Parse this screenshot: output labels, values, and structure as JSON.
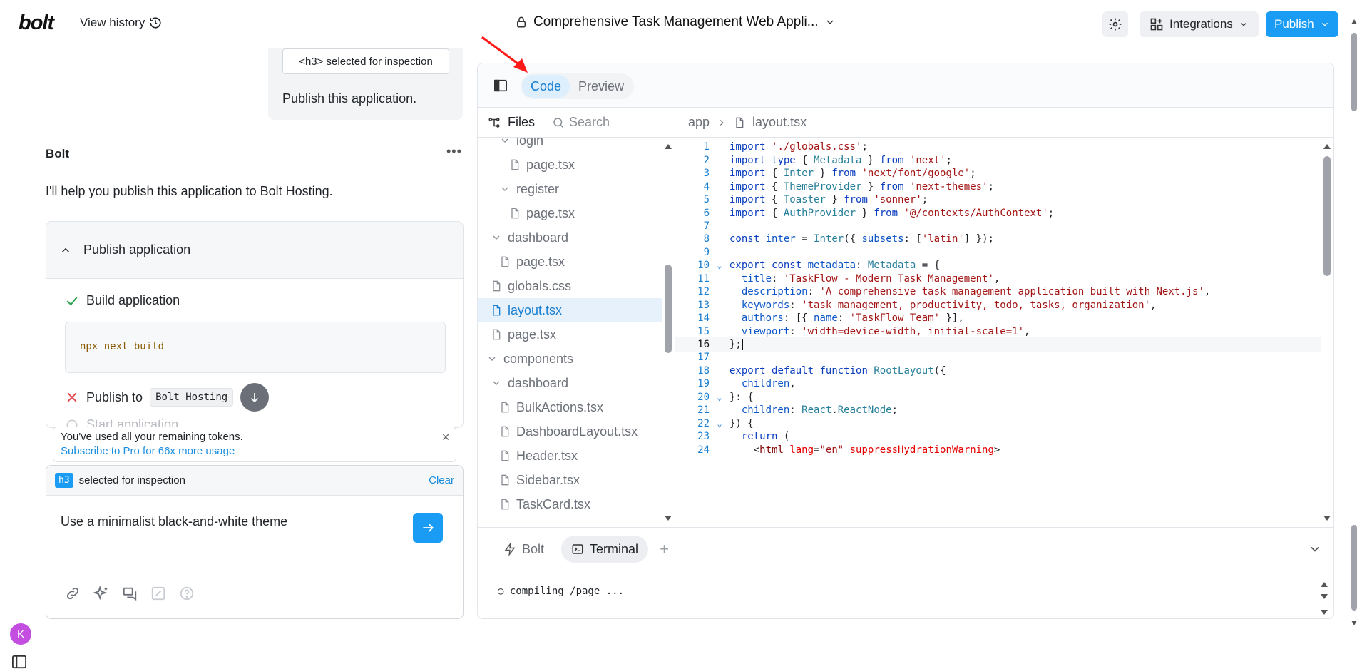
{
  "topbar": {
    "logo": "bolt",
    "view_history": "View history",
    "project_title": "Comprehensive Task Management Web Appli...",
    "integrations": "Integrations",
    "publish": "Publish"
  },
  "chat": {
    "inspect_chip": "<h3> selected for inspection",
    "user_message": "Publish this application.",
    "assistant_name": "Bolt",
    "assistant_message": "I'll help you publish this application to Bolt Hosting.",
    "publish_card": {
      "title": "Publish application",
      "step1_label": "Build application",
      "step1_command": "npx next build",
      "step2_label": "Publish to",
      "step2_target": "Bolt Hosting",
      "step3_label": "Start application"
    },
    "token_banner": {
      "line1": "You've used all your remaining tokens.",
      "line2": "Subscribe to Pro for 66x more usage"
    },
    "input": {
      "badge": "h3",
      "selected_text": "selected for inspection",
      "clear": "Clear",
      "value": "Use a minimalist black-and-white theme"
    },
    "avatar_initial": "K"
  },
  "workbench": {
    "tabs": [
      "Code",
      "Preview"
    ],
    "files_label": "Files",
    "search_label": "Search",
    "breadcrumb": [
      "app",
      "layout.tsx"
    ],
    "tree": [
      {
        "name": "login",
        "type": "folder"
      },
      {
        "name": "page.tsx",
        "type": "file"
      },
      {
        "name": "register",
        "type": "folder"
      },
      {
        "name": "page.tsx",
        "type": "file"
      },
      {
        "name": "dashboard",
        "type": "folder"
      },
      {
        "name": "page.tsx",
        "type": "file"
      },
      {
        "name": "globals.css",
        "type": "file"
      },
      {
        "name": "layout.tsx",
        "type": "file",
        "selected": true
      },
      {
        "name": "page.tsx",
        "type": "file"
      },
      {
        "name": "components",
        "type": "folder"
      },
      {
        "name": "dashboard",
        "type": "folder"
      },
      {
        "name": "BulkActions.tsx",
        "type": "file"
      },
      {
        "name": "DashboardLayout.tsx",
        "type": "file"
      },
      {
        "name": "Header.tsx",
        "type": "file"
      },
      {
        "name": "Sidebar.tsx",
        "type": "file"
      },
      {
        "name": "TaskCard.tsx",
        "type": "file"
      }
    ],
    "code_lines": [
      "import './globals.css';",
      "import type { Metadata } from 'next';",
      "import { Inter } from 'next/font/google';",
      "import { ThemeProvider } from 'next-themes';",
      "import { Toaster } from 'sonner';",
      "import { AuthProvider } from '@/contexts/AuthContext';",
      "",
      "const inter = Inter({ subsets: ['latin'] });",
      "",
      "export const metadata: Metadata = {",
      "  title: 'TaskFlow - Modern Task Management',",
      "  description: 'A comprehensive task management application built with Next.js',",
      "  keywords: 'task management, productivity, todo, tasks, organization',",
      "  authors: [{ name: 'TaskFlow Team' }],",
      "  viewport: 'width=device-width, initial-scale=1',",
      "};",
      "",
      "export default function RootLayout({",
      "  children,",
      "}: {",
      "  children: React.ReactNode;",
      "}) {",
      "  return (",
      "    <html lang=\"en\" suppressHydrationWarning>"
    ],
    "current_line": 16,
    "terminal_tabs": [
      "Bolt",
      "Terminal"
    ],
    "terminal_output": "○ compiling /page ..."
  },
  "colors": {
    "accent": "#1a9cf4",
    "selected_bg": "#e6f1fc",
    "annotation_arrow": "#ff1a1a"
  }
}
